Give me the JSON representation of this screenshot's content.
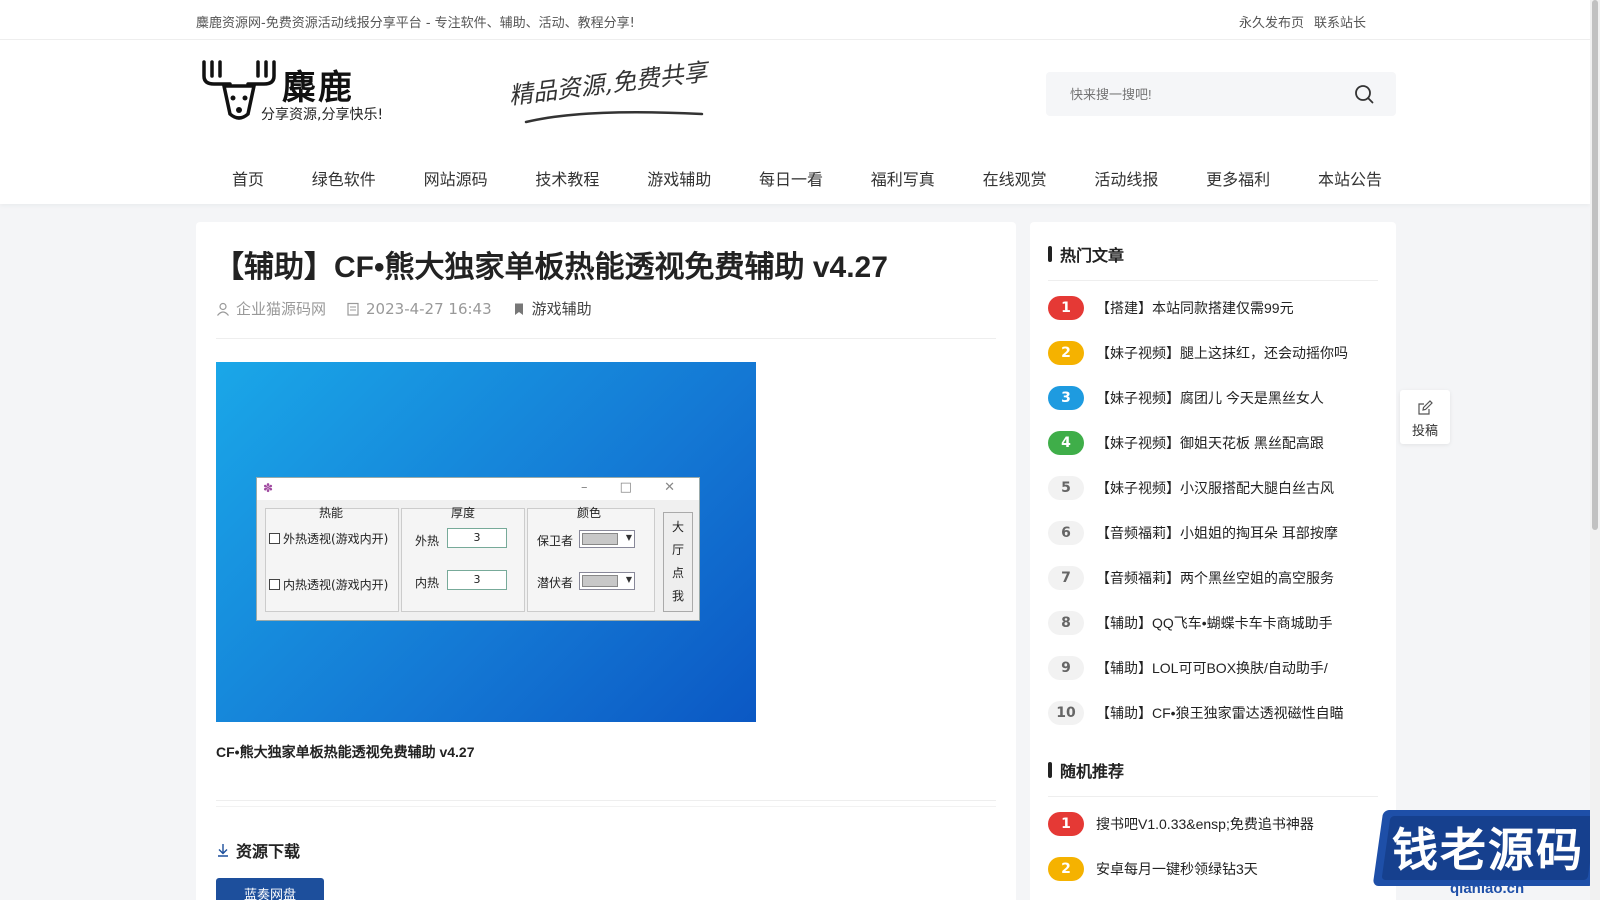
{
  "topbar": {
    "slogan": "麋鹿资源网-免费资源活动线报分享平台 - 专注软件、辅助、活动、教程分享!",
    "links": [
      "永久发布页",
      "联系站长"
    ]
  },
  "logo": {
    "brand": "麋鹿",
    "tagline": "分享资源,分享快乐!"
  },
  "calligraphy": "精品资源,免费共享",
  "search": {
    "placeholder": "快来搜一搜吧!",
    "icon": "search-icon"
  },
  "nav": [
    "首页",
    "绿色软件",
    "网站源码",
    "技术教程",
    "游戏辅助",
    "每日一看",
    "福利写真",
    "在线观赏",
    "活动线报",
    "更多福利",
    "本站公告"
  ],
  "article": {
    "title": "【辅助】CF•熊大独家单板热能透视免费辅助 v4.27",
    "author": "企业猫源码网",
    "date": "2023-4-27 16:43",
    "category": "游戏辅助",
    "caption": "CF•熊大独家单板热能透视免费辅助 v4.27",
    "download_title": "资源下载",
    "download_button": "蓝奏网盘"
  },
  "screenshot_window": {
    "col_thermal": "热能",
    "col_thickness": "厚度",
    "col_color": "颜色",
    "cb_outer": "外热透视(游戏内开)",
    "cb_inner": "内热透视(游戏内开)",
    "lbl_outer": "外热",
    "lbl_inner": "内热",
    "val_outer": "3",
    "val_inner": "3",
    "lbl_defender": "保卫者",
    "lbl_lurker": "潜伏者",
    "side_chars": [
      "大",
      "厅",
      "点",
      "我"
    ]
  },
  "sidebar": {
    "hot_title": "热门文章",
    "hot": [
      {
        "rank": "1",
        "text": "【搭建】本站同款搭建仅需99元"
      },
      {
        "rank": "2",
        "text": "【妹子视频】腿上这抹红，还会动摇你吗"
      },
      {
        "rank": "3",
        "text": "【妹子视频】腐团儿 今天是黑丝女人"
      },
      {
        "rank": "4",
        "text": "【妹子视频】御姐天花板 黑丝配高跟"
      },
      {
        "rank": "5",
        "text": "【妹子视频】小汉服搭配大腿白丝古风"
      },
      {
        "rank": "6",
        "text": "【音频福莉】小姐姐的掏耳朵 耳部按摩"
      },
      {
        "rank": "7",
        "text": "【音频福莉】两个黑丝空姐的高空服务"
      },
      {
        "rank": "8",
        "text": "【辅助】QQ飞车•蝴蝶卡车卡商城助手"
      },
      {
        "rank": "9",
        "text": "【辅助】LOL可可BOX换肤/自动助手/"
      },
      {
        "rank": "10",
        "text": "【辅助】CF•狼王独家雷达透视磁性自瞄"
      }
    ],
    "random_title": "随机推荐",
    "random": [
      {
        "rank": "1",
        "text": "搜书吧V1.0.33&ensp;免费追书神器"
      },
      {
        "rank": "2",
        "text": "安卓每月一键秒领绿钻3天"
      }
    ]
  },
  "tougao": "投稿",
  "watermark": {
    "big": "钱老源码",
    "small": "qianlao.cn"
  },
  "colors": {
    "rank1": "#e53935",
    "rank2": "#f5b200",
    "rank3": "#1e9be0",
    "rank4": "#3fae49",
    "download_button": "#1d4f9c"
  }
}
